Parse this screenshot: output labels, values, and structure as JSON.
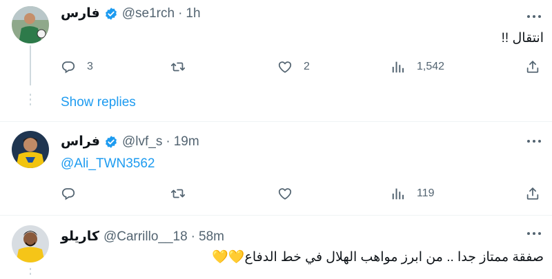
{
  "colors": {
    "link": "#1d9bf0",
    "muted": "#536471",
    "text": "#0f1419",
    "verified": "#1d9bf0",
    "heart_emoji": "#f4c043"
  },
  "tweets": [
    {
      "display_name": "فارس",
      "handle": "@se1rch",
      "separator": "·",
      "time": "1h",
      "text": "انتقال !!",
      "counts": {
        "replies": "3",
        "retweets": "",
        "likes": "2",
        "views": "1,542"
      }
    },
    {
      "display_name": "فراس",
      "handle": "@lvf_s",
      "separator": "·",
      "time": "19m",
      "mention": "@Ali_TWN3562",
      "counts": {
        "replies": "",
        "retweets": "",
        "likes": "",
        "views": "119"
      }
    },
    {
      "display_name": "كاريلو",
      "handle": "@Carrillo__18",
      "separator": "·",
      "time": "58m",
      "text": "صفقة ممتاز جدا .. من ابرز مواهب الهلال في خط الدفاع💛💛"
    }
  ],
  "show_replies_label": "Show replies",
  "icons": [
    "verified-badge-icon",
    "more-icon",
    "reply-icon",
    "retweet-icon",
    "like-icon",
    "views-icon",
    "share-icon"
  ]
}
